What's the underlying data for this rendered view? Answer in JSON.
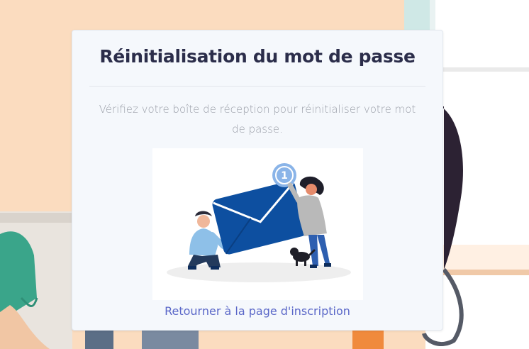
{
  "page": {
    "title": "Réinitialisation du mot de passe",
    "message": "Vérifiez votre boîte de réception pour réinitialiser votre mot de passe.",
    "return_link": "Retourner à la page d'inscription"
  },
  "illustration": {
    "badge_count": "1",
    "icon": "envelope-notification-illustration"
  },
  "colors": {
    "title": "#2b2d4a",
    "link": "#5a67c8",
    "envelope": "#0d4fa0",
    "badge": "#8ab4e8"
  }
}
